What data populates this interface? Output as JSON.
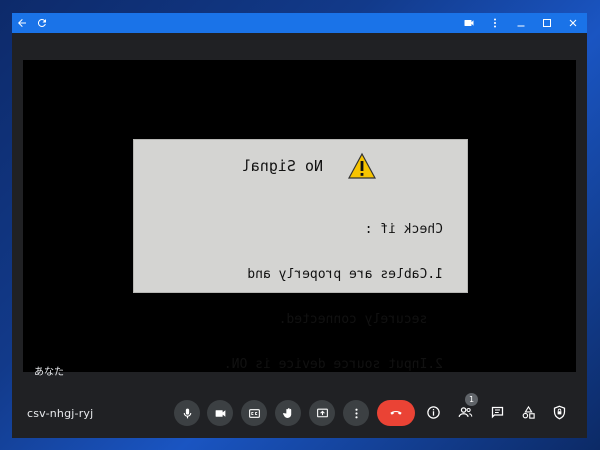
{
  "titlebar": {
    "icons": [
      "back-arrow-icon",
      "refresh-icon",
      "camera-indicator-icon",
      "more-vert-icon",
      "minimize-icon",
      "maximize-icon",
      "close-icon"
    ],
    "color": "#1a73e8"
  },
  "no_signal": {
    "title": "No Signal",
    "lines": [
      "Check if :",
      "1.Cables are properly and",
      "  securely connected.",
      "2.Input source device is ON."
    ],
    "icon": "warning-icon"
  },
  "self_view": {
    "label": "あなた"
  },
  "meeting": {
    "code": "csv-nhgj-ryj"
  },
  "controls": {
    "buttons": [
      "mic-icon",
      "camera-icon",
      "captions-icon",
      "raise-hand-icon",
      "present-screen-icon",
      "more-options-icon"
    ],
    "hangup_color": "#ea4335",
    "side": [
      "info-icon",
      "people-icon",
      "chat-icon",
      "activities-icon",
      "host-controls-icon"
    ],
    "participant_count": "1"
  }
}
